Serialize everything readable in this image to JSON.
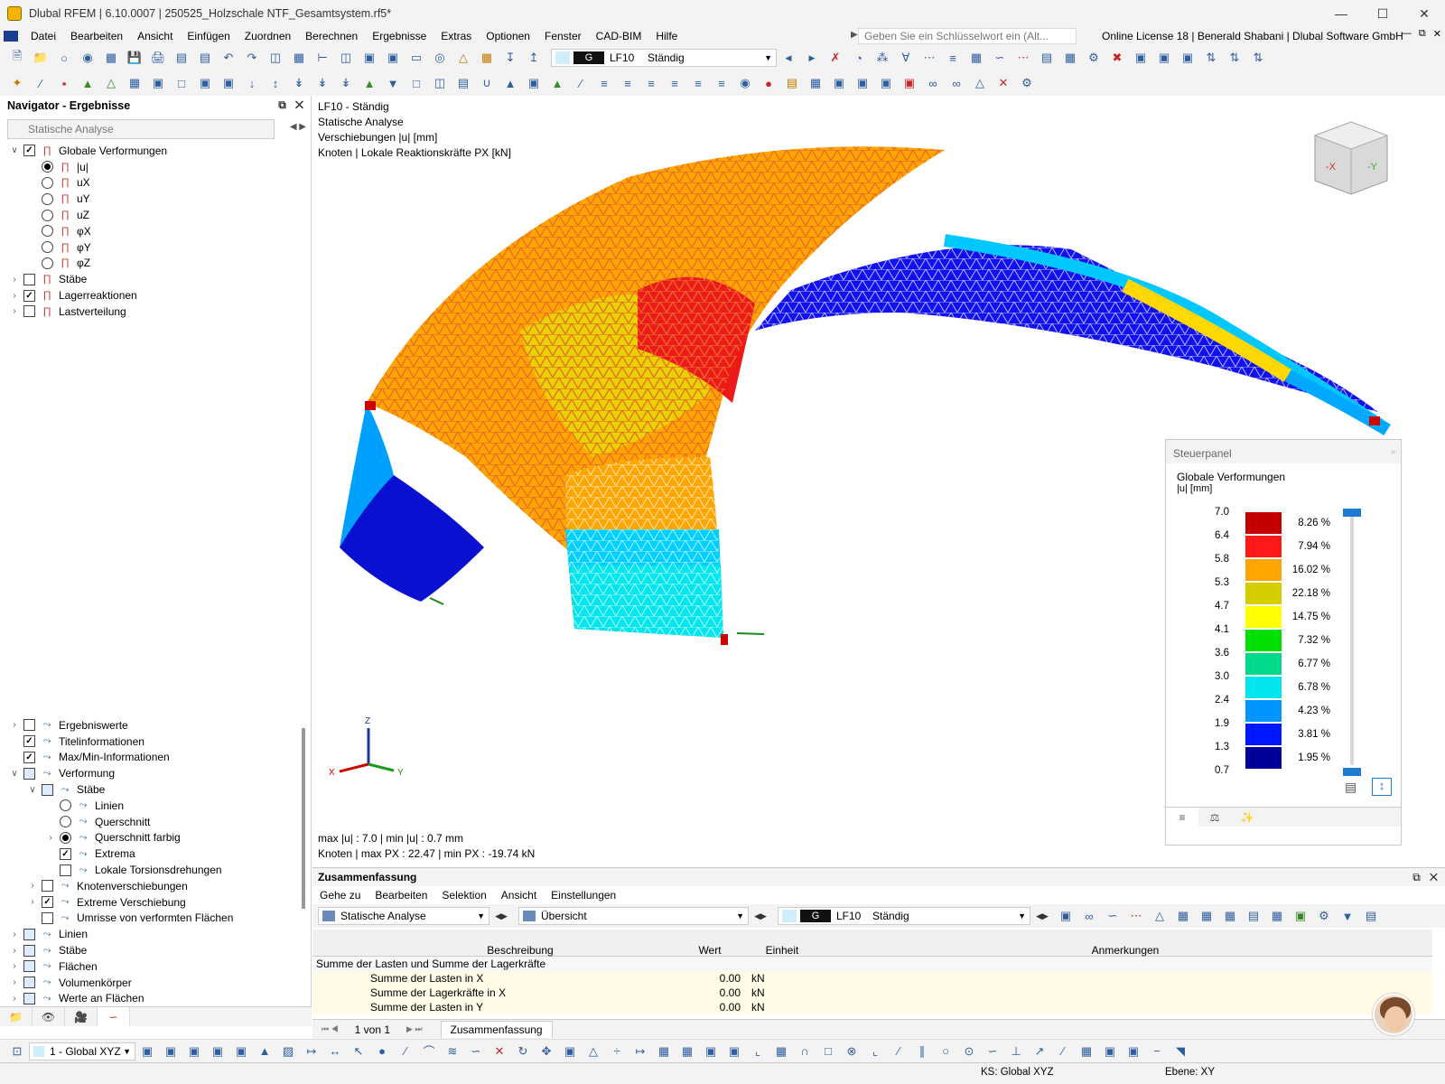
{
  "app": {
    "title": "Dlubal RFEM | 6.10.0007 | 250525_Holzschale NTF_Gesamtsystem.rf5*"
  },
  "menu": {
    "items": [
      "Datei",
      "Bearbeiten",
      "Ansicht",
      "Einfügen",
      "Zuordnen",
      "Berechnen",
      "Ergebnisse",
      "Extras",
      "Optionen",
      "Fenster",
      "CAD-BIM",
      "Hilfe"
    ],
    "search_placeholder": "Geben Sie ein Schlüsselwort ein (Alt...",
    "license": "Online License 18 | Benerald Shabani | Dlubal Software GmbH"
  },
  "toolbar": {
    "load_case_code": "G",
    "load_case": "LF10",
    "load_case_name": "Ständig"
  },
  "navigator": {
    "title": "Navigator - Ergebnisse",
    "combo": "Statische Analyse",
    "tree_top": [
      {
        "label": "Globale Verformungen",
        "level": 0,
        "ctl": "cb",
        "state": "on",
        "exp": "v"
      },
      {
        "label": "|u|",
        "level": 1,
        "ctl": "rb",
        "state": "on"
      },
      {
        "label": "uX",
        "level": 1,
        "ctl": "rb",
        "state": "off"
      },
      {
        "label": "uY",
        "level": 1,
        "ctl": "rb",
        "state": "off"
      },
      {
        "label": "uZ",
        "level": 1,
        "ctl": "rb",
        "state": "off"
      },
      {
        "label": "φX",
        "level": 1,
        "ctl": "rb",
        "state": "off"
      },
      {
        "label": "φY",
        "level": 1,
        "ctl": "rb",
        "state": "off"
      },
      {
        "label": "φZ",
        "level": 1,
        "ctl": "rb",
        "state": "off"
      },
      {
        "label": "Stäbe",
        "level": 0,
        "ctl": "cb",
        "state": "off",
        "exp": ">"
      },
      {
        "label": "Lagerreaktionen",
        "level": 0,
        "ctl": "cb",
        "state": "on",
        "exp": ">"
      },
      {
        "label": "Lastverteilung",
        "level": 0,
        "ctl": "cb",
        "state": "off",
        "exp": ">"
      }
    ],
    "tree_bottom": [
      {
        "label": "Ergebniswerte",
        "level": 0,
        "ctl": "cb",
        "state": "off",
        "exp": ">"
      },
      {
        "label": "Titelinformationen",
        "level": 0,
        "ctl": "cb",
        "state": "on"
      },
      {
        "label": "Max/Min-Informationen",
        "level": 0,
        "ctl": "cb",
        "state": "on"
      },
      {
        "label": "Verformung",
        "level": 0,
        "ctl": "cb",
        "state": "part",
        "exp": "v"
      },
      {
        "label": "Stäbe",
        "level": 1,
        "ctl": "cb",
        "state": "part",
        "exp": "v"
      },
      {
        "label": "Linien",
        "level": 2,
        "ctl": "rb",
        "state": "off"
      },
      {
        "label": "Querschnitt",
        "level": 2,
        "ctl": "rb",
        "state": "off"
      },
      {
        "label": "Querschnitt farbig",
        "level": 2,
        "ctl": "rb",
        "state": "on",
        "exp": ">"
      },
      {
        "label": "Extrema",
        "level": 2,
        "ctl": "cb",
        "state": "on"
      },
      {
        "label": "Lokale Torsionsdrehungen",
        "level": 2,
        "ctl": "cb",
        "state": "off"
      },
      {
        "label": "Knotenverschiebungen",
        "level": 1,
        "ctl": "cb",
        "state": "off",
        "exp": ">"
      },
      {
        "label": "Extreme Verschiebung",
        "level": 1,
        "ctl": "cb",
        "state": "on",
        "exp": ">"
      },
      {
        "label": "Umrisse von verformten Flächen",
        "level": 1,
        "ctl": "cb",
        "state": "off"
      },
      {
        "label": "Linien",
        "level": 0,
        "ctl": "cb",
        "state": "part",
        "exp": ">"
      },
      {
        "label": "Stäbe",
        "level": 0,
        "ctl": "cb",
        "state": "part",
        "exp": ">"
      },
      {
        "label": "Flächen",
        "level": 0,
        "ctl": "cb",
        "state": "part",
        "exp": ">"
      },
      {
        "label": "Volumenkörper",
        "level": 0,
        "ctl": "cb",
        "state": "part",
        "exp": ">"
      },
      {
        "label": "Werte an Flächen",
        "level": 0,
        "ctl": "cb",
        "state": "part",
        "exp": ">"
      }
    ]
  },
  "viewport": {
    "info": [
      "LF10 - Ständig",
      "Statische Analyse",
      "Verschiebungen |u| [mm]",
      "Knoten | Lokale Reaktionskräfte PX [kN]"
    ],
    "maxmin1": "max |u| : 7.0 | min |u| : 0.7 mm",
    "maxmin2": "Knoten | max PX : 22.47 | min PX : -19.74 kN",
    "cube": {
      "x": "-X",
      "y": "-Y"
    },
    "axes": {
      "x": "X",
      "y": "Y",
      "z": "Z"
    }
  },
  "panel": {
    "title": "Steuerpanel",
    "heading": "Globale Verformungen",
    "unit": "|u| [mm]",
    "values": [
      "7.0",
      "6.4",
      "5.8",
      "5.3",
      "4.7",
      "4.1",
      "3.6",
      "3.0",
      "2.4",
      "1.9",
      "1.3",
      "0.7"
    ],
    "bands": [
      {
        "color": "#c40000",
        "pct": "8.26 %"
      },
      {
        "color": "#ff1a1a",
        "pct": "7.94 %"
      },
      {
        "color": "#ffa500",
        "pct": "16.02 %"
      },
      {
        "color": "#d6cd00",
        "pct": "22.18 %"
      },
      {
        "color": "#ffff00",
        "pct": "14.75 %"
      },
      {
        "color": "#00e000",
        "pct": "7.32 %"
      },
      {
        "color": "#00d88a",
        "pct": "6.77 %"
      },
      {
        "color": "#00e5ee",
        "pct": "6.78 %"
      },
      {
        "color": "#0095ff",
        "pct": "4.23 %"
      },
      {
        "color": "#0018ff",
        "pct": "3.81 %"
      },
      {
        "color": "#000099",
        "pct": "1.95 %"
      }
    ]
  },
  "summary": {
    "title": "Zusammenfassung",
    "menu": [
      "Gehe zu",
      "Bearbeiten",
      "Selektion",
      "Ansicht",
      "Einstellungen"
    ],
    "combo1": "Statische Analyse",
    "combo2": "Übersicht",
    "lc_code": "G",
    "lc": "LF10",
    "lc_name": "Ständig",
    "headers": {
      "desc": "Beschreibung",
      "value": "Wert",
      "unit": "Einheit",
      "notes": "Anmerkungen"
    },
    "section": "Summe der Lasten und Summe der Lagerkräfte",
    "rows": [
      {
        "desc": "Summe der Lasten in X",
        "value": "0.00",
        "unit": "kN"
      },
      {
        "desc": "Summe der Lagerkräfte in X",
        "value": "0.00",
        "unit": "kN"
      },
      {
        "desc": "Summe der Lasten in Y",
        "value": "0.00",
        "unit": "kN"
      }
    ],
    "pager": "1 von 1",
    "tab": "Zusammenfassung"
  },
  "bottombar": {
    "coord_system": "1 - Global XYZ"
  },
  "status": {
    "ks": "KS: Global XYZ",
    "ebene": "Ebene: XY"
  }
}
